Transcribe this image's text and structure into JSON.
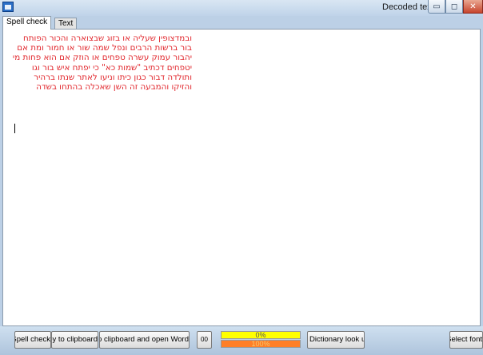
{
  "window": {
    "title": "Decoded text",
    "minimize_glyph": "▭",
    "maximize_glyph": "◻",
    "close_glyph": "✕"
  },
  "tabs": [
    {
      "label": "Spell check",
      "active": true
    },
    {
      "label": "Text",
      "active": false
    }
  ],
  "editor": {
    "text_color": "#e1242a",
    "lines": [
      "ובמדצופין שעליה או בזוג שבצוארה והכור הפותח",
      "בור ברשות הרבים ונפל שמה שור או חמור ומת אם",
      "יהבור עמוק עשרה טפחים או הוזק אם הוא פחות מי",
      "יטפחים דכתיב \"שמות כא\" כי יפתח איש בור וגו",
      "ותולדה דבור כגון כיתו וניעו לאתר שנתו ברהיר",
      "והזיקו והמבעה זה השן שאכלה בהתחו בשדה"
    ]
  },
  "toolbar": {
    "spell_check": "Spell check",
    "copy_clipboard": "Copy to clipboard",
    "copy_open_word": "Copy to clipboard and open Word",
    "small_button": "00",
    "progress_top": "0%",
    "progress_top_value": 0,
    "progress_bottom": "100%",
    "progress_bottom_value": 100,
    "dictionary": "Dictionary look up",
    "select_font": "Select font"
  }
}
